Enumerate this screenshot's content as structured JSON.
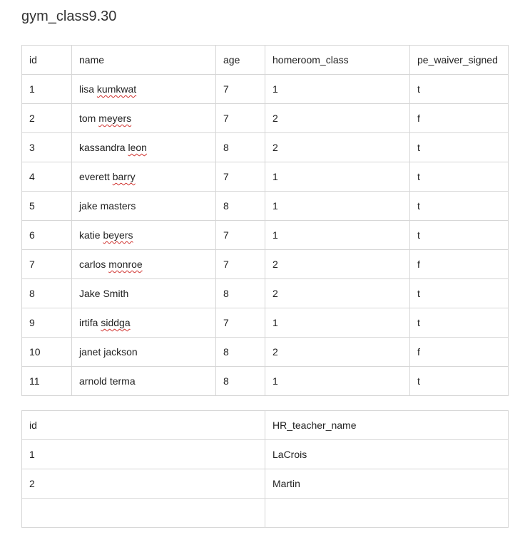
{
  "title": "gym_class9.30",
  "students": {
    "headers": [
      "id",
      "name",
      "age",
      "homeroom_class",
      "pe_waiver_signed"
    ],
    "rows": [
      {
        "id": "1",
        "first": "lisa ",
        "second": "kumkwat",
        "second_flagged": true,
        "age": "7",
        "homeroom_class": "1",
        "pe_waiver_signed": "t"
      },
      {
        "id": "2",
        "first": "tom ",
        "second": "meyers",
        "second_flagged": true,
        "age": "7",
        "homeroom_class": "2",
        "pe_waiver_signed": "f"
      },
      {
        "id": "3",
        "first": "kassandra ",
        "second": "leon",
        "second_flagged": true,
        "age": "8",
        "homeroom_class": "2",
        "pe_waiver_signed": "t"
      },
      {
        "id": "4",
        "first": "everett ",
        "second": "barry",
        "second_flagged": true,
        "age": "7",
        "homeroom_class": "1",
        "pe_waiver_signed": "t"
      },
      {
        "id": "5",
        "first": "jake ",
        "second": "masters",
        "second_flagged": false,
        "age": "8",
        "homeroom_class": "1",
        "pe_waiver_signed": "t"
      },
      {
        "id": "6",
        "first": "katie ",
        "second": "beyers",
        "second_flagged": true,
        "age": "7",
        "homeroom_class": "1",
        "pe_waiver_signed": "t"
      },
      {
        "id": "7",
        "first": "carlos ",
        "second": "monroe",
        "second_flagged": true,
        "age": "7",
        "homeroom_class": "2",
        "pe_waiver_signed": "f"
      },
      {
        "id": "8",
        "first": "Jake ",
        "second": "Smith",
        "second_flagged": false,
        "age": "8",
        "homeroom_class": "2",
        "pe_waiver_signed": "t"
      },
      {
        "id": "9",
        "first": "irtifa ",
        "second": "siddga",
        "second_flagged": true,
        "age": "7",
        "homeroom_class": "1",
        "pe_waiver_signed": "t"
      },
      {
        "id": "10",
        "first": "janet ",
        "second": "jackson",
        "second_flagged": false,
        "age": "8",
        "homeroom_class": "2",
        "pe_waiver_signed": "f"
      },
      {
        "id": "11",
        "first": "arnold ",
        "second": "terma",
        "second_flagged": false,
        "age": "8",
        "homeroom_class": "1",
        "pe_waiver_signed": "t"
      }
    ]
  },
  "teachers": {
    "headers": [
      "id",
      "HR_teacher_name"
    ],
    "rows": [
      {
        "id": "1",
        "HR_teacher_name": "LaCrois"
      },
      {
        "id": "2",
        "HR_teacher_name": "Martin"
      },
      {
        "id": "",
        "HR_teacher_name": ""
      }
    ]
  }
}
